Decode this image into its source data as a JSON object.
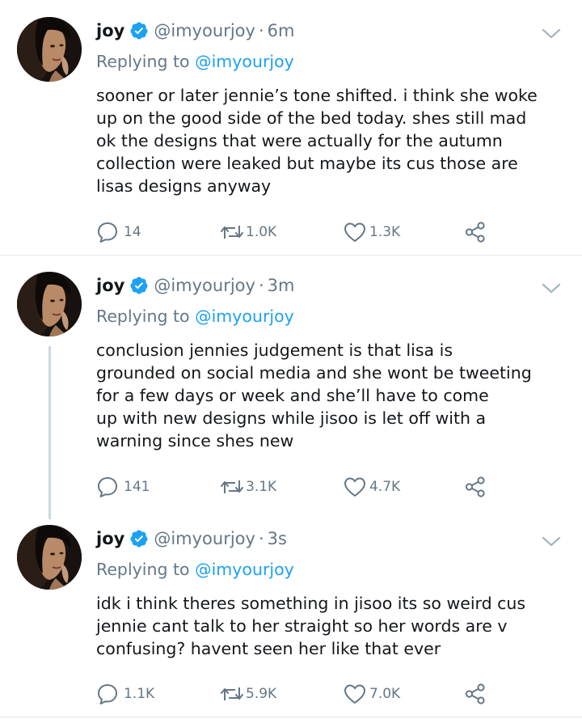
{
  "tweets": [
    {
      "name": "joy",
      "handle": "@imyourjoy",
      "separator": "·",
      "time": "6m",
      "replying_prefix": "Replying to",
      "replying_to": "@imyourjoy",
      "lines": [
        "sooner or later jennie’s tone shifted. i think she woke",
        "up on the good side of the bed today. shes still mad",
        "ok the designs that were actually for the autumn",
        "collection were leaked but maybe its cus those are",
        "lisas designs anyway"
      ],
      "replies": "14",
      "retweets": "1.0K",
      "likes": "1.3K"
    },
    {
      "name": "joy",
      "handle": "@imyourjoy",
      "separator": "·",
      "time": "3m",
      "replying_prefix": "Replying to",
      "replying_to": "@imyourjoy",
      "lines": [
        "conclusion jennies judgement is that lisa is",
        "grounded on social media and she wont be tweeting",
        "for a few days or week and she’ll have to come",
        "up with new designs while jisoo is let off with a",
        "warning since shes new"
      ],
      "replies": "141",
      "retweets": "3.1K",
      "likes": "4.7K"
    },
    {
      "name": "joy",
      "handle": "@imyourjoy",
      "separator": "·",
      "time": "3s",
      "replying_prefix": "Replying to",
      "replying_to": "@imyourjoy",
      "lines": [
        "idk i think theres something in jisoo its so weird cus",
        "jennie cant talk to her straight so her words are v",
        "confusing? havent seen her like that ever"
      ],
      "replies": "1.1K",
      "retweets": "5.9K",
      "likes": "7.0K"
    }
  ],
  "colors": {
    "accent": "#1da1f2",
    "secondary_text": "#657786",
    "primary_text": "#14171a",
    "divider": "#e1e8ed"
  },
  "icons": [
    "verified-badge-icon",
    "chevron-down-icon",
    "reply-icon",
    "retweet-icon",
    "like-icon",
    "share-icon"
  ]
}
